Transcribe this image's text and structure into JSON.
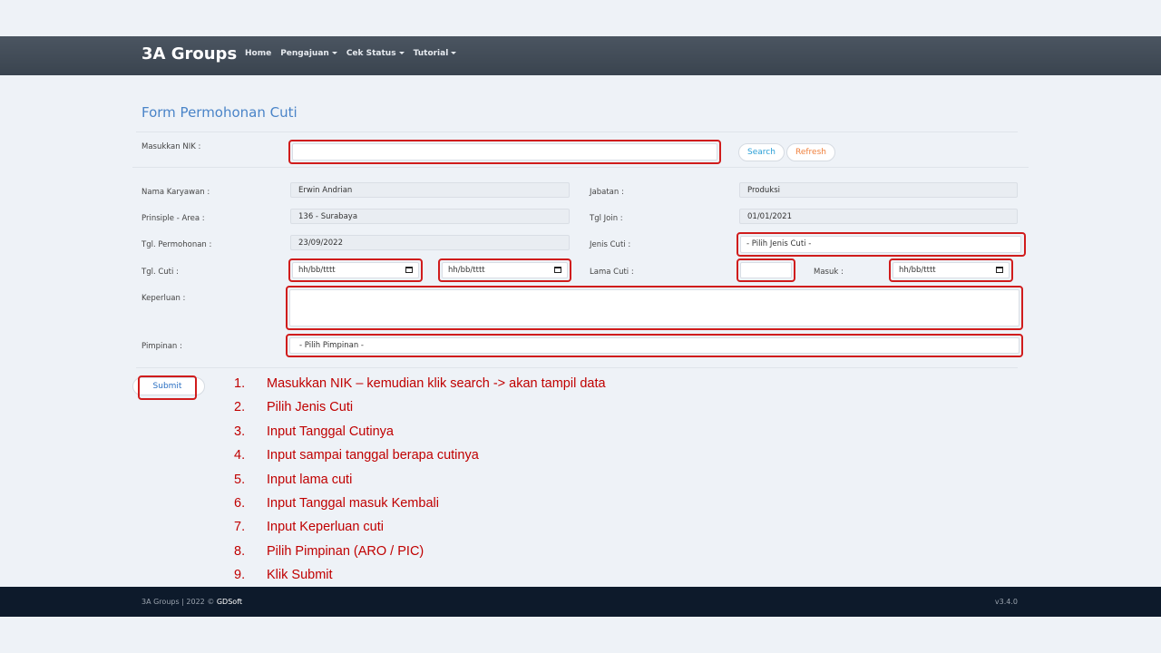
{
  "navbar": {
    "brand": "3A Groups",
    "items": [
      {
        "label": "Home",
        "dropdown": false
      },
      {
        "label": "Pengajuan",
        "dropdown": true
      },
      {
        "label": "Cek Status",
        "dropdown": true
      },
      {
        "label": "Tutorial",
        "dropdown": true
      }
    ]
  },
  "form": {
    "title": "Form Permohonan Cuti",
    "nik_label": "Masukkan NIK :",
    "nik_value": "",
    "search_label": "Search",
    "refresh_label": "Refresh",
    "nama_label": "Nama Karyawan :",
    "nama_value": "Erwin Andrian",
    "jabatan_label": "Jabatan :",
    "jabatan_value": "Produksi",
    "principle_label": "Prinsiple - Area :",
    "principle_value": "136 - Surabaya",
    "tgl_join_label": "Tgl Join :",
    "tgl_join_value": "01/01/2021",
    "tgl_permohonan_label": "Tgl. Permohonan :",
    "tgl_permohonan_value": "23/09/2022",
    "jenis_cuti_label": "Jenis Cuti :",
    "jenis_cuti_value": "- Pilih Jenis Cuti -",
    "tgl_cuti_label": "Tgl. Cuti :",
    "tgl_cuti_from_placeholder": "hh/bb/tttt",
    "tgl_cuti_to_placeholder": "hh/bb/tttt",
    "lama_cuti_label": "Lama Cuti :",
    "lama_cuti_value": "",
    "masuk_label": "Masuk :",
    "masuk_placeholder": "hh/bb/tttt",
    "keperluan_label": "Keperluan :",
    "keperluan_value": "",
    "pimpinan_label": "Pimpinan :",
    "pimpinan_value": "- Pilih Pimpinan -",
    "submit_label": "Submit"
  },
  "instructions": [
    {
      "num": "1.",
      "text": "Masukkan NIK – kemudian klik  search -> akan tampil data"
    },
    {
      "num": "2.",
      "text": "Pilih  Jenis Cuti"
    },
    {
      "num": "3.",
      "text": "Input Tanggal Cutinya"
    },
    {
      "num": "4.",
      "text": "Input sampai tanggal berapa cutinya"
    },
    {
      "num": "5.",
      "text": "Input lama cuti"
    },
    {
      "num": "6.",
      "text": "Input Tanggal masuk Kembali"
    },
    {
      "num": "7.",
      "text": "Input Keperluan  cuti"
    },
    {
      "num": "8.",
      "text": "Pilih  Pimpinan  (ARO / PIC)"
    },
    {
      "num": "9.",
      "text": "Klik  Submit"
    }
  ],
  "footer": {
    "copyright": "3A Groups | 2022 ©",
    "company": "GDSoft",
    "version": "v3.4.0"
  },
  "colors": {
    "highlight": "#d01c1c",
    "title": "#4a84c8",
    "instruction_text": "#c00000",
    "search": "#2a9fd6",
    "refresh": "#f0803c",
    "footer_bg": "#0d1a2b"
  }
}
